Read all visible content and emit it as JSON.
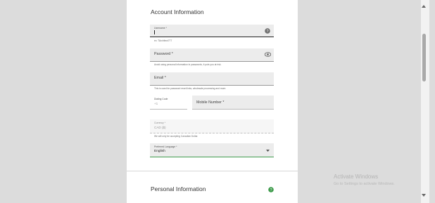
{
  "account_section": {
    "title": "Account Information"
  },
  "username": {
    "label": "Username *",
    "value": "",
    "helper": "ex: TArchitect777",
    "help_icon": "help-icon"
  },
  "password": {
    "label": "Password *",
    "helper": "Avoid using personal information in passwords, it puts you at risk.",
    "toggle_icon": "eye-icon"
  },
  "email": {
    "label": "Email *",
    "helper": "This is used for password reset links, wholesale processing and more."
  },
  "dialing_code": {
    "label": "Dialing Code",
    "value": "+1"
  },
  "mobile": {
    "label": "Mobile Number *"
  },
  "currency": {
    "label": "Currency *",
    "value": "CAD ($)",
    "helper": "We will only be accepting Canadian Dollar."
  },
  "language": {
    "label": "Preferred Language *",
    "value": "English",
    "dropdown_icon": "caret-down-icon"
  },
  "personal_section": {
    "title": "Personal Information",
    "status_icon": "help-icon"
  },
  "watermark": {
    "title": "Activate Windows",
    "subtitle": "Go to Settings to activate Windows."
  },
  "colors": {
    "accent_green": "#3d9b4b",
    "field_bg": "#ececec",
    "page_bg": "#dcdcdc"
  }
}
